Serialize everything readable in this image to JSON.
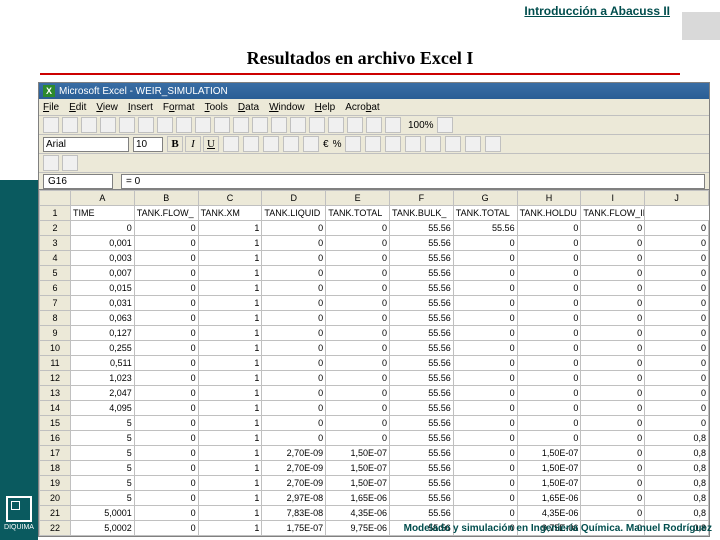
{
  "header": "Introducción a Abacuss II",
  "title": "Resultados en archivo Excel I",
  "footer": "Modelado y simulación en Ingeniería Química. Manuel Rodríguez",
  "logo_text": "DIQUIMA",
  "excel": {
    "window_title": "Microsoft Excel - WEIR_SIMULATION",
    "menu": [
      "File",
      "Edit",
      "View",
      "Insert",
      "Format",
      "Tools",
      "Data",
      "Window",
      "Help",
      "Acrobat"
    ],
    "zoom": "100%",
    "font": "Arial",
    "font_size": "10",
    "biu": [
      "B",
      "I",
      "U"
    ],
    "euro": "€",
    "pct": "%",
    "cell_ref": "G16",
    "fx_value": "= 0",
    "col_letters": [
      "",
      "A",
      "B",
      "C",
      "D",
      "E",
      "F",
      "G",
      "H",
      "I",
      "J"
    ],
    "headers_row": "1",
    "headers": [
      "TIME",
      "TANK.FLOW_",
      "TANK.XM",
      "TANK.LIQUID",
      "TANK.TOTAL",
      "TANK.BULK_",
      "TANK.TOTAL",
      "TANK.HOLDU",
      "TANK.FLOW_IN Kmol/s"
    ],
    "rows": [
      {
        "r": "2",
        "cells": [
          "0",
          "0",
          "1",
          "0",
          "0",
          "55.56",
          "55.56",
          "0",
          "0",
          "0"
        ]
      },
      {
        "r": "3",
        "cells": [
          "0,001",
          "0",
          "1",
          "0",
          "0",
          "55.56",
          "0",
          "0",
          "0",
          "0"
        ]
      },
      {
        "r": "4",
        "cells": [
          "0,003",
          "0",
          "1",
          "0",
          "0",
          "55.56",
          "0",
          "0",
          "0",
          "0"
        ]
      },
      {
        "r": "5",
        "cells": [
          "0,007",
          "0",
          "1",
          "0",
          "0",
          "55.56",
          "0",
          "0",
          "0",
          "0"
        ]
      },
      {
        "r": "6",
        "cells": [
          "0,015",
          "0",
          "1",
          "0",
          "0",
          "55.56",
          "0",
          "0",
          "0",
          "0"
        ]
      },
      {
        "r": "7",
        "cells": [
          "0,031",
          "0",
          "1",
          "0",
          "0",
          "55.56",
          "0",
          "0",
          "0",
          "0"
        ]
      },
      {
        "r": "8",
        "cells": [
          "0,063",
          "0",
          "1",
          "0",
          "0",
          "55.56",
          "0",
          "0",
          "0",
          "0"
        ]
      },
      {
        "r": "9",
        "cells": [
          "0,127",
          "0",
          "1",
          "0",
          "0",
          "55.56",
          "0",
          "0",
          "0",
          "0"
        ]
      },
      {
        "r": "10",
        "cells": [
          "0,255",
          "0",
          "1",
          "0",
          "0",
          "55.56",
          "0",
          "0",
          "0",
          "0"
        ]
      },
      {
        "r": "11",
        "cells": [
          "0,511",
          "0",
          "1",
          "0",
          "0",
          "55.56",
          "0",
          "0",
          "0",
          "0"
        ]
      },
      {
        "r": "12",
        "cells": [
          "1,023",
          "0",
          "1",
          "0",
          "0",
          "55.56",
          "0",
          "0",
          "0",
          "0"
        ]
      },
      {
        "r": "13",
        "cells": [
          "2,047",
          "0",
          "1",
          "0",
          "0",
          "55.56",
          "0",
          "0",
          "0",
          "0"
        ]
      },
      {
        "r": "14",
        "cells": [
          "4,095",
          "0",
          "1",
          "0",
          "0",
          "55.56",
          "0",
          "0",
          "0",
          "0"
        ]
      },
      {
        "r": "15",
        "cells": [
          "5",
          "0",
          "1",
          "0",
          "0",
          "55.56",
          "0",
          "0",
          "0",
          "0"
        ]
      },
      {
        "r": "16",
        "cells": [
          "5",
          "0",
          "1",
          "0",
          "0",
          "55.56",
          "0",
          "0",
          "0",
          "0,8"
        ]
      },
      {
        "r": "17",
        "cells": [
          "5",
          "0",
          "1",
          "2,70E-09",
          "1,50E-07",
          "55.56",
          "0",
          "1,50E-07",
          "0",
          "0,8"
        ]
      },
      {
        "r": "18",
        "cells": [
          "5",
          "0",
          "1",
          "2,70E-09",
          "1,50E-07",
          "55.56",
          "0",
          "1,50E-07",
          "0",
          "0,8"
        ]
      },
      {
        "r": "19",
        "cells": [
          "5",
          "0",
          "1",
          "2,70E-09",
          "1,50E-07",
          "55.56",
          "0",
          "1,50E-07",
          "0",
          "0,8"
        ]
      },
      {
        "r": "20",
        "cells": [
          "5",
          "0",
          "1",
          "2,97E-08",
          "1,65E-06",
          "55.56",
          "0",
          "1,65E-06",
          "0",
          "0,8"
        ]
      },
      {
        "r": "21",
        "cells": [
          "5,0001",
          "0",
          "1",
          "7,83E-08",
          "4,35E-06",
          "55.56",
          "0",
          "4,35E-06",
          "0",
          "0,8"
        ]
      },
      {
        "r": "22",
        "cells": [
          "5,0002",
          "0",
          "1",
          "1,75E-07",
          "9,75E-06",
          "55.56",
          "0",
          "9,75E-06",
          "0",
          "0,8"
        ]
      }
    ]
  }
}
